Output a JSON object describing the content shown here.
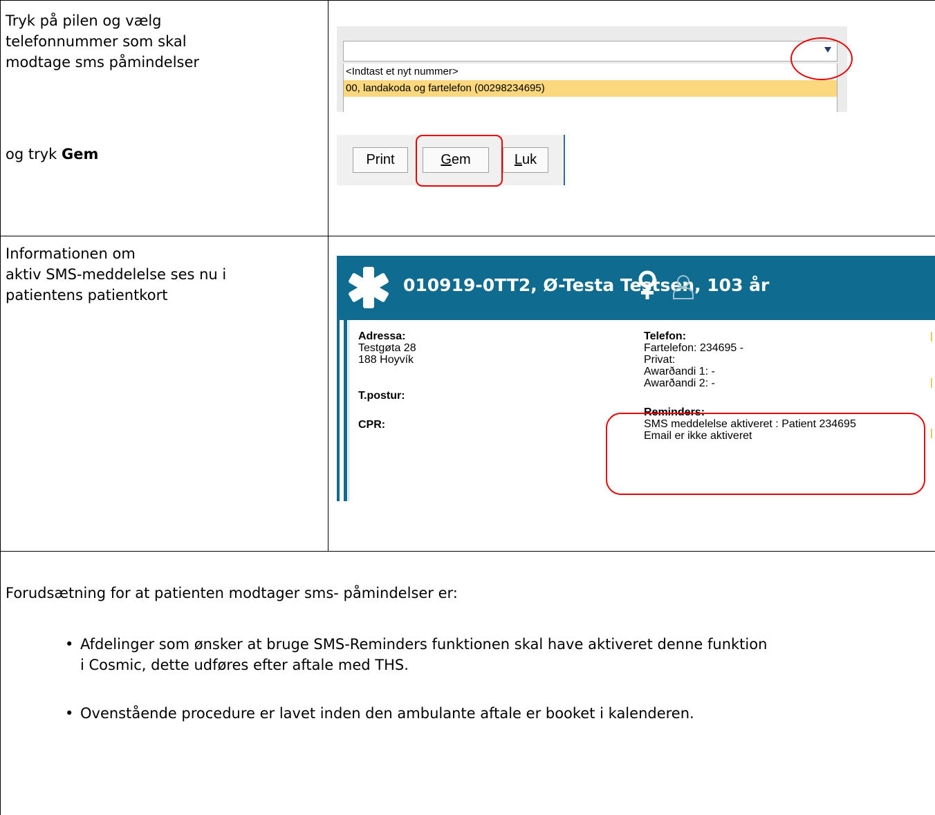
{
  "row1": {
    "instruction_lines": [
      "Tryk på pilen og vælg",
      "telefonnummer som skal",
      "modtage sms påmindelser"
    ],
    "gem_prefix": "og tryk ",
    "gem_bold": "Gem"
  },
  "dropdown": {
    "value": "",
    "options": [
      "<Indtast et nyt nummer>",
      "00, landakoda og fartelefon (00298234695)"
    ],
    "selected_index": 1
  },
  "buttons": {
    "print": "Print",
    "gem_first": "G",
    "gem_rest": "em",
    "luk_first": "L",
    "luk_rest": "uk"
  },
  "row2": {
    "text_lines": [
      "Informationen om",
      "aktiv SMS-meddelelse ses nu i",
      "patientens patientkort"
    ]
  },
  "patient": {
    "title": "010919-0TT2, Ø-Testa Testsen, 103 år",
    "left": {
      "adresse_label": "Adressa:",
      "street": "Testgøta 28",
      "city": "188 Hoyvík",
      "postur_label": "T.postur:",
      "cpr_label": "CPR:"
    },
    "right": {
      "telefon_label": "Telefon:",
      "fartelefon": "Fartelefon: 234695 -",
      "privat": "Privat:",
      "awar1": "Awarðandi 1: -",
      "awar2": "Awarðandi 2: -",
      "reminders_label": "Reminders:",
      "sms": "SMS meddelelse aktiveret : Patient 234695",
      "email": "Email er ikke aktiveret"
    }
  },
  "row3": {
    "intro": "Forudsætning for at patienten modtager sms- påmindelser er:",
    "bullets": [
      {
        "line1": "Afdelinger som ønsker at bruge SMS-Reminders funktionen skal have aktiveret denne funktion",
        "line2": "i Cosmic, dette udføres efter aftale med THS."
      },
      {
        "line1": "Ovenstående procedure er lavet inden den ambulante aftale er booket i kalenderen.",
        "line2": ""
      }
    ]
  },
  "colors": {
    "accent_red": "#e00000",
    "header_blue": "#0f6b8f",
    "selected_option": "#fbd77e"
  }
}
